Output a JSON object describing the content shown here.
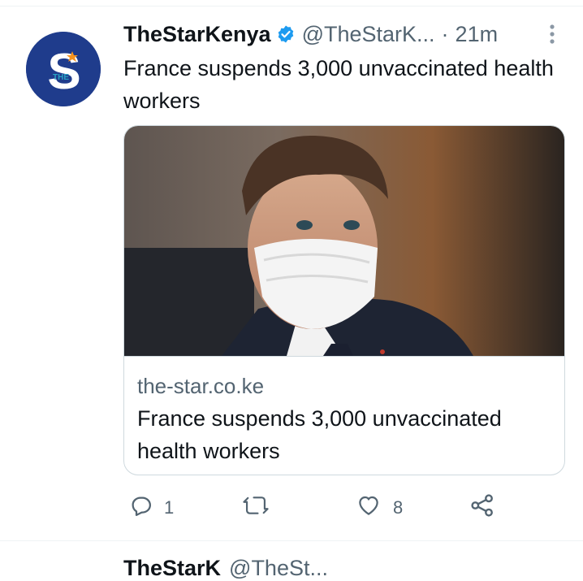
{
  "tweet": {
    "display_name": "TheStarKenya",
    "handle": "@TheStarK...",
    "separator": "·",
    "time": "21m",
    "text": "France suspends 3,000 unvaccinated health workers",
    "avatar": {
      "letter": "S",
      "small_text": "THE",
      "bg_color": "#1f3c8c"
    },
    "card": {
      "domain": "the-star.co.ke",
      "title": "France suspends 3,000 unvaccinated health workers"
    },
    "actions": {
      "reply_count": "1",
      "retweet_count": "",
      "like_count": "8"
    }
  },
  "next_tweet": {
    "display_name": "TheStarK",
    "handle": "@TheSt..."
  },
  "colors": {
    "verified": "#1d9bf0",
    "secondary_text": "#536471",
    "border": "#cfd9de"
  },
  "icons": [
    "verified-badge-icon",
    "more-vertical-icon",
    "reply-icon",
    "retweet-icon",
    "like-icon",
    "share-icon"
  ]
}
